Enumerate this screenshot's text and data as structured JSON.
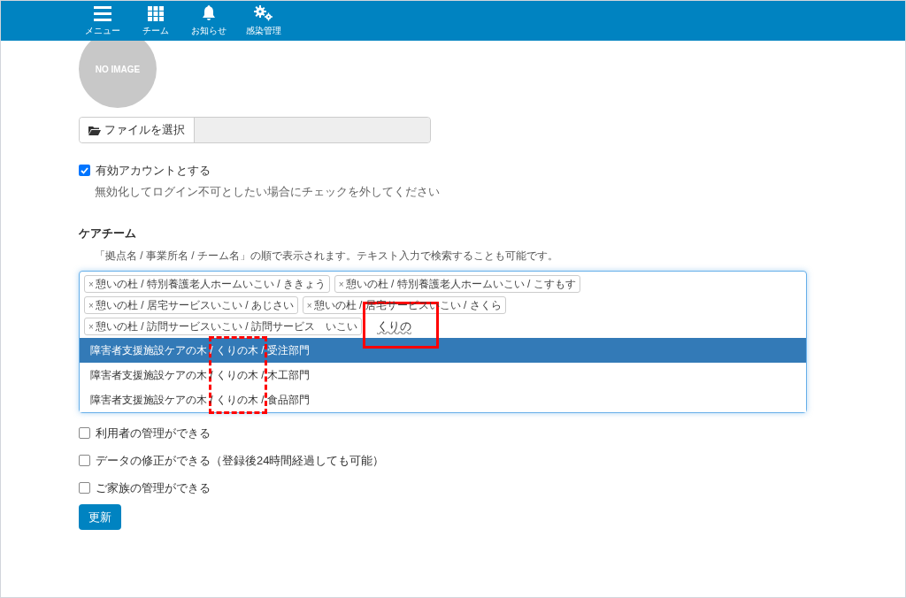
{
  "nav": [
    {
      "kind": "menu",
      "label": "メニュー"
    },
    {
      "kind": "grid",
      "label": "チーム"
    },
    {
      "kind": "bell",
      "label": "お知らせ"
    },
    {
      "kind": "gears",
      "label": "感染管理"
    }
  ],
  "avatar": {
    "text": "NO IMAGE"
  },
  "file_input": {
    "button": "ファイルを選択"
  },
  "active_account": {
    "label": "有効アカウントとする",
    "checked": true,
    "hint": "無効化してログイン不可としたい場合にチェックを外してください"
  },
  "care_team": {
    "title": "ケアチーム",
    "description": "「拠点名 / 事業所名 / チーム名」の順で表示されます。テキスト入力で検索することも可能です。",
    "tags": [
      {
        "remove": "×",
        "label": "憩いの杜 / 特別養護老人ホームいこい / ききょう"
      },
      {
        "remove": "×",
        "label": "憩いの杜 / 特別養護老人ホームいこい / こすもす"
      },
      {
        "remove": "×",
        "label": "憩いの杜 / 居宅サービスいこい / あじさい"
      },
      {
        "remove": "×",
        "label": "憩いの杜 / 居宅サービスいこい / さくら"
      },
      {
        "remove": "×",
        "label": "憩いの杜 / 訪問サービスいこい / 訪問サービス　いこい"
      }
    ],
    "search_value": "くりの",
    "options": [
      {
        "label": "障害者支援施設ケアの木 / くりの木 / 受注部門",
        "selected": true
      },
      {
        "label": "障害者支援施設ケアの木 / くりの木 / 木工部門",
        "selected": false
      },
      {
        "label": "障害者支援施設ケアの木 / くりの木 / 食品部門",
        "selected": false
      }
    ]
  },
  "permissions": [
    {
      "label": "利用者の管理ができる",
      "checked": false
    },
    {
      "label": "データの修正ができる（登録後24時間経過しても可能）",
      "checked": false
    },
    {
      "label": "ご家族の管理ができる",
      "checked": false
    }
  ],
  "submit": "更新"
}
